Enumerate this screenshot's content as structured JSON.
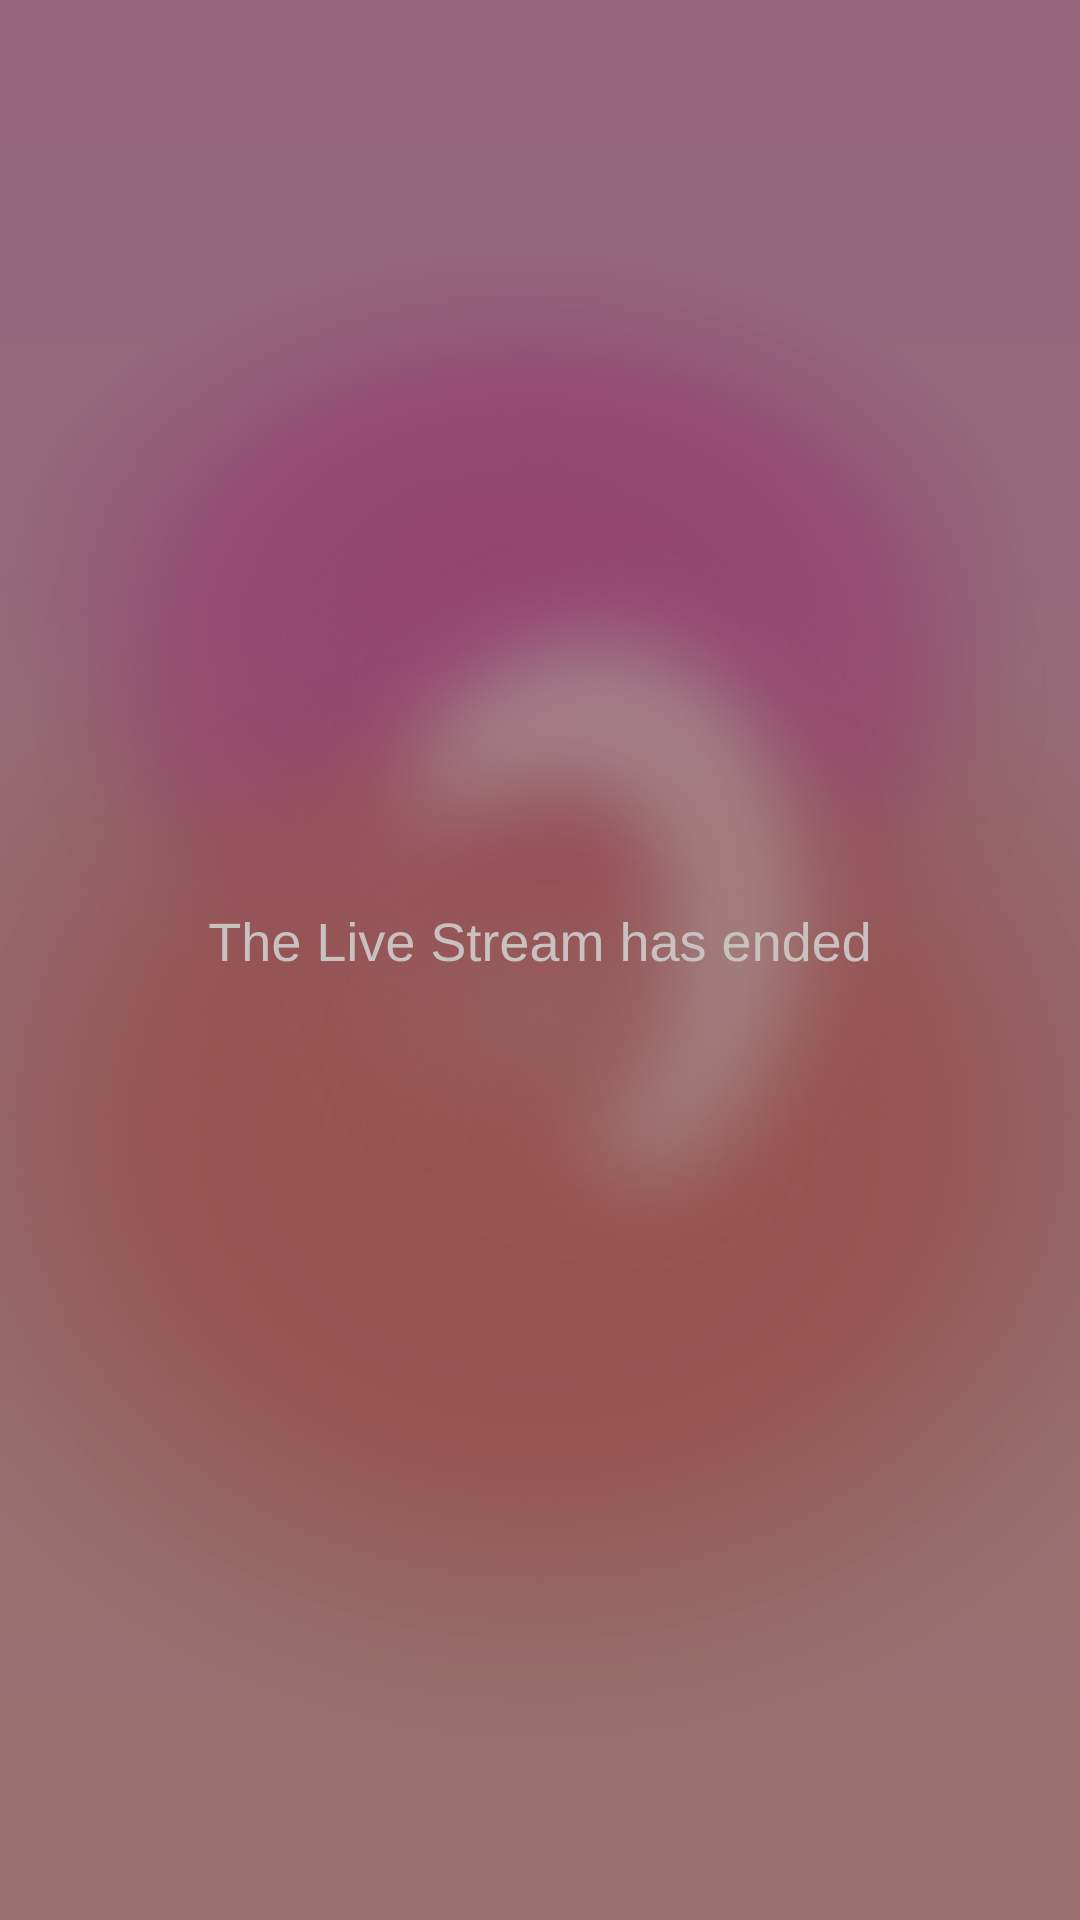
{
  "stream": {
    "status_message": "The Live Stream has ended"
  },
  "colors": {
    "background_top": "#95667e",
    "background_bottom": "#96706c",
    "blob_pink": "#93446f",
    "blob_red": "#965450",
    "arc_glow": "#aa9696",
    "message_text": "#c8c1bf"
  }
}
